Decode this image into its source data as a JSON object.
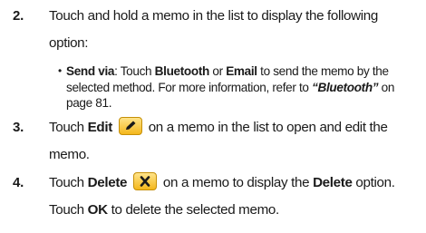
{
  "steps": [
    {
      "number": "2.",
      "line1": "Touch and hold a memo in the list to display the following",
      "line2": "option:",
      "bullet": {
        "symbol": "•",
        "label": "Send via",
        "t1": ": Touch ",
        "opt1": "Bluetooth",
        "t2": " or ",
        "opt2": "Email",
        "t3": " to send the memo by the selected method. For more information, refer to ",
        "ref": "“Bluetooth”",
        "t4": " on page 81."
      }
    },
    {
      "number": "3.",
      "pre": "Touch ",
      "bold": "Edit",
      "icon": "pencil-icon",
      "post": " on a memo in the list to open and edit the",
      "line2": "memo."
    },
    {
      "number": "4.",
      "pre": "Touch ",
      "bold": "Delete",
      "icon": "close-x-icon",
      "mid": " on a memo to display the ",
      "bold2": "Delete",
      "post": " option.",
      "l2pre": "Touch ",
      "l2bold": "OK",
      "l2post": " to delete the selected memo."
    }
  ],
  "colors": {
    "icon_fill": "#f4b71c",
    "icon_border": "#c58f07"
  }
}
